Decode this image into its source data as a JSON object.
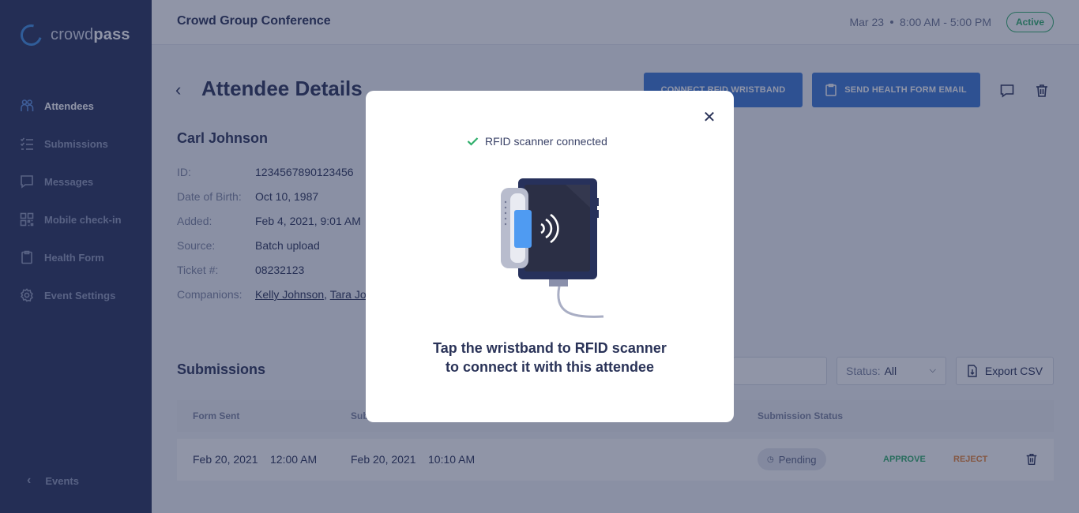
{
  "sidebar": {
    "logo": {
      "part1": "crowd",
      "part2": "pass"
    },
    "items": [
      {
        "label": "Attendees",
        "icon": "attendees-icon",
        "active": true
      },
      {
        "label": "Submissions",
        "icon": "checklist-icon",
        "active": false
      },
      {
        "label": "Messages",
        "icon": "chat-icon",
        "active": false
      },
      {
        "label": "Mobile check-in",
        "icon": "qr-icon",
        "active": false
      },
      {
        "label": "Health Form",
        "icon": "clipboard-icon",
        "active": false
      },
      {
        "label": "Event Settings",
        "icon": "gear-icon",
        "active": false
      }
    ],
    "back_label": "Events"
  },
  "header": {
    "title": "Crowd Group Conference",
    "date": "Mar 23",
    "time": "8:00 AM - 5:00 PM",
    "status": "Active"
  },
  "page": {
    "title": "Attendee Details",
    "connect_button": "CONNECT RFID WRISTBAND",
    "email_button": "SEND HEALTH FORM EMAIL"
  },
  "attendee": {
    "name": "Carl Johnson",
    "fields": [
      {
        "label": "ID:",
        "value": "1234567890123456"
      },
      {
        "label": "Date of Birth:",
        "value": "Oct 10, 1987"
      },
      {
        "label": "Added:",
        "value": "Feb 4, 2021, 9:01 AM"
      },
      {
        "label": "Source:",
        "value": "Batch upload"
      },
      {
        "label": "Ticket #:",
        "value": "08232123"
      }
    ],
    "companions_label": "Companions:",
    "companions": [
      "Kelly Johnson",
      "Tara Jo"
    ]
  },
  "submissions": {
    "title": "Submissions",
    "status_filter": {
      "label": "Status:",
      "value": "All"
    },
    "export_label": "Export CSV",
    "columns": [
      "Form Sent",
      "Sub",
      "Submission Status"
    ],
    "rows": [
      {
        "form_sent_date": "Feb 20, 2021",
        "form_sent_time": "12:00 AM",
        "submitted_date": "Feb 20, 2021",
        "submitted_time": "10:10 AM",
        "status": "Pending",
        "approve": "APPROVE",
        "reject": "REJECT"
      }
    ]
  },
  "modal": {
    "status_text": "RFID scanner connected",
    "message_line1": "Tap the wristband to RFID scanner",
    "message_line2": "to connect it with this attendee"
  },
  "colors": {
    "sidebar_bg": "#27315b",
    "primary": "#3b76d4",
    "success": "#2fae6b",
    "warning": "#e8863a",
    "text_dark": "#2a3358"
  }
}
